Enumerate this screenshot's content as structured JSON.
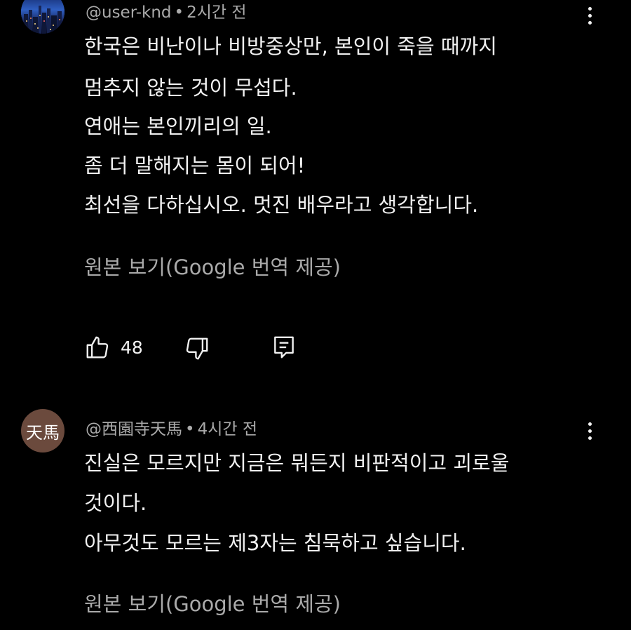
{
  "comments": [
    {
      "author": "@user-knd",
      "separator": "•",
      "time": "2시간 전",
      "lines": [
        "한국은 비난이나 비방중상만, 본인이 죽을 때까지",
        "멈추지 않는 것이 무섭다.",
        "연애는 본인끼리의 일.",
        "좀 더 말해지는 몸이 되어!",
        "최선을 다하십시오. 멋진 배우라고 생각합니다."
      ],
      "translation_link": "원본 보기(Google 번역 제공)",
      "likes": "48",
      "like_icon": "thumbs-up-icon",
      "dislike_icon": "thumbs-down-icon",
      "reply_icon": "reply-icon"
    },
    {
      "author": "@西園寺天馬",
      "avatar_text": "天馬",
      "separator": "•",
      "time": "4시간 전",
      "lines": [
        "진실은 모르지만 지금은 뭐든지 비판적이고 괴로울",
        "것이다.",
        "아무것도 모르는 제3자는 침묵하고 싶습니다."
      ],
      "translation_link": "원본 보기(Google 번역 제공)"
    }
  ],
  "colors": {
    "background": "#000000",
    "primary_text": "#f1f1f1",
    "secondary_text": "#aaaaaa",
    "avatar2_bg": "#6b4a3d"
  }
}
